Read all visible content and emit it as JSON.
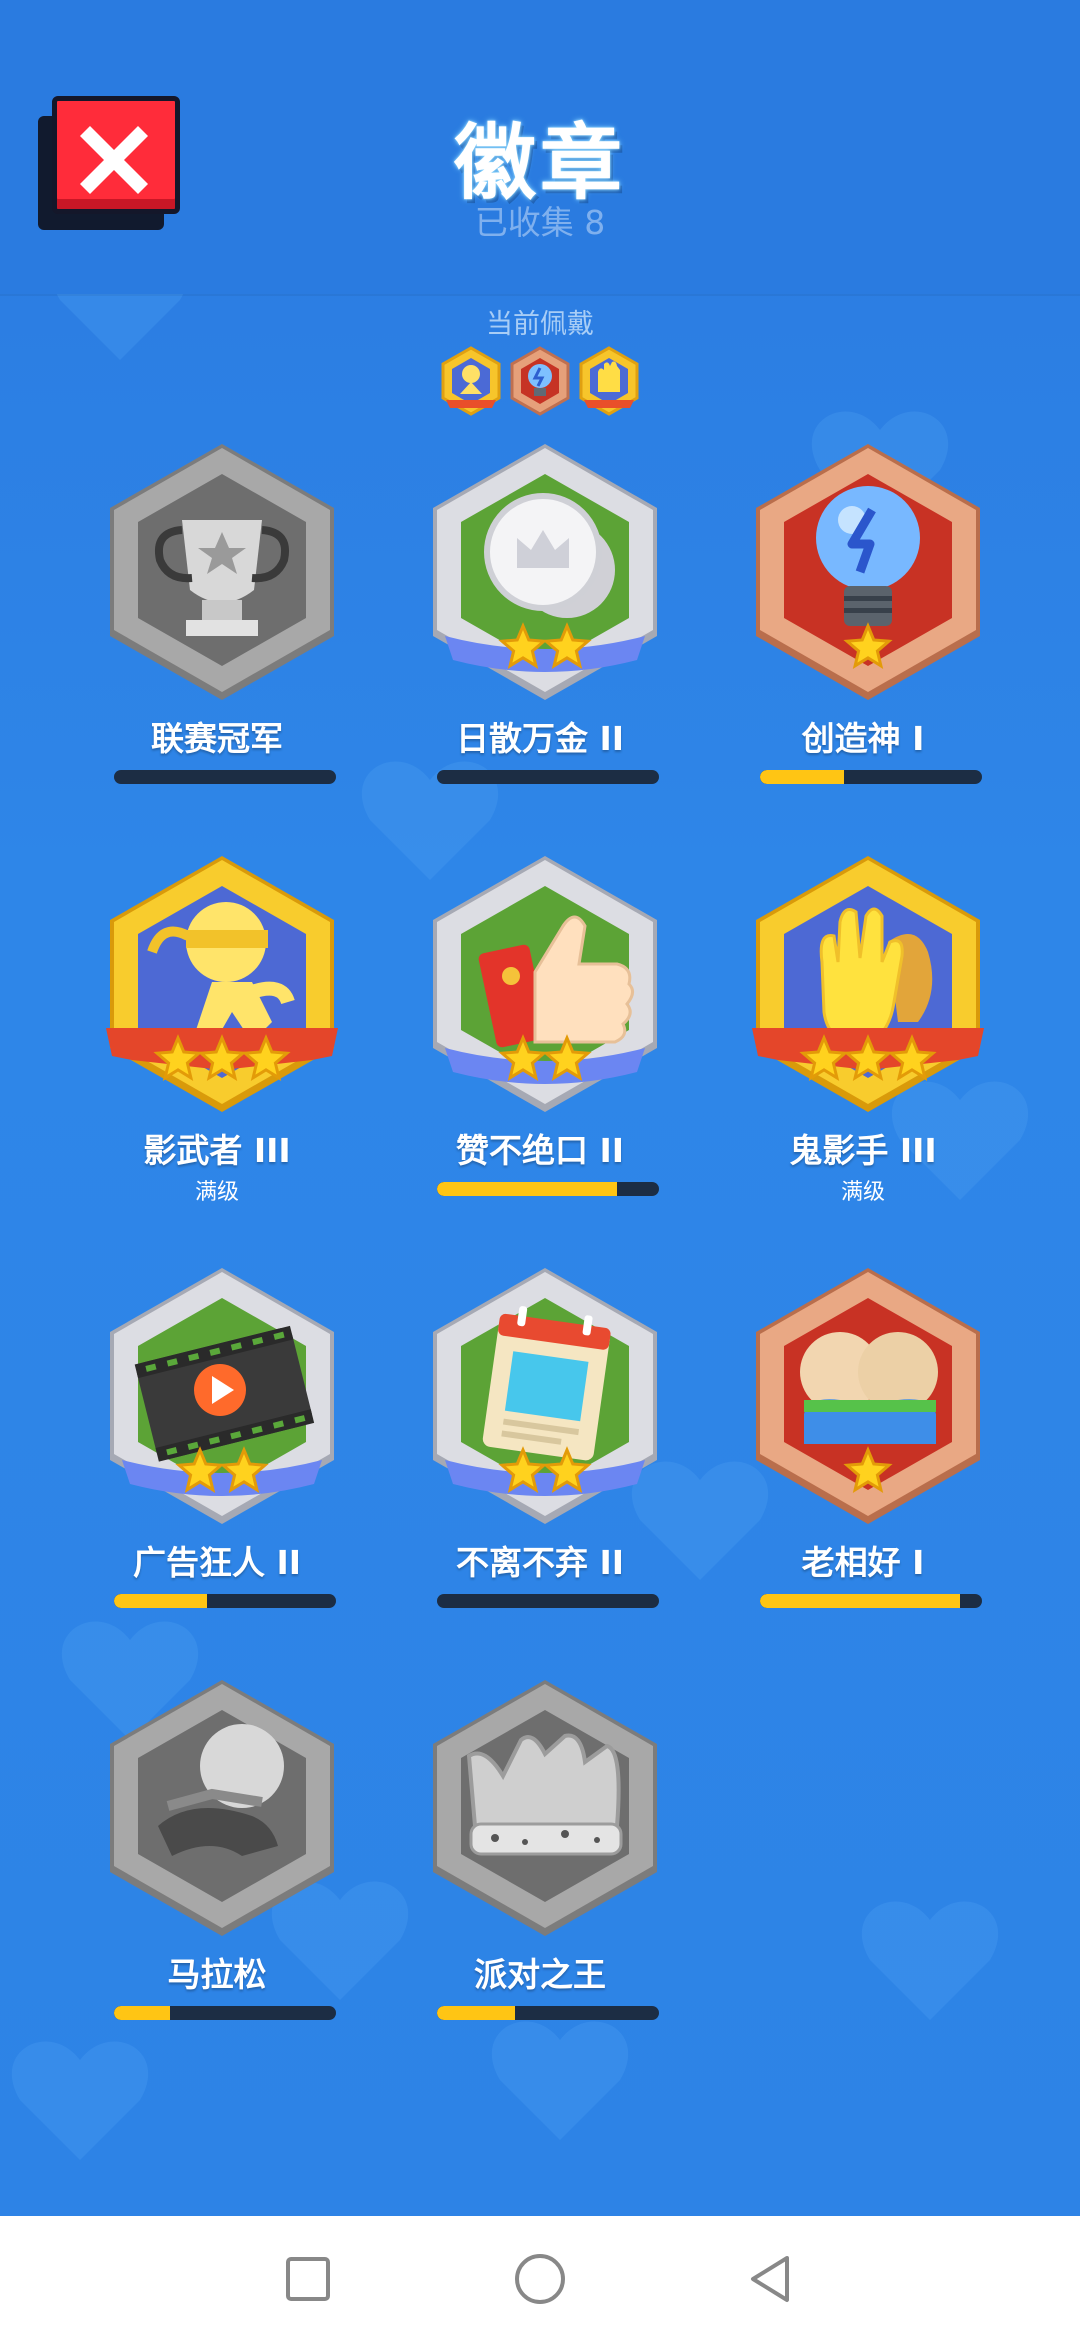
{
  "header": {
    "title": "徽章",
    "subtitle": "已收集 8"
  },
  "worn": {
    "label": "当前佩戴",
    "badges": [
      "shadow-ninja-mini",
      "lightbulb-mini",
      "glove-mini"
    ]
  },
  "badges": [
    {
      "name": "联赛冠军",
      "progress": 0,
      "maxed": false,
      "icon": "trophy-icon",
      "stars": 0,
      "locked": true
    },
    {
      "name": "日散万金 II",
      "progress": 0,
      "maxed": false,
      "icon": "coin-crown-icon",
      "stars": 2
    },
    {
      "name": "创造神 I",
      "progress": 0.38,
      "maxed": false,
      "icon": "lightbulb-icon",
      "stars": 1
    },
    {
      "name": "影武者 III",
      "maxed": true,
      "maxed_label": "满级",
      "icon": "ninja-icon",
      "stars": 3
    },
    {
      "name": "赞不绝口 II",
      "progress": 0.81,
      "maxed": false,
      "icon": "thumbs-up-icon",
      "stars": 2
    },
    {
      "name": "鬼影手 III",
      "maxed": true,
      "maxed_label": "满级",
      "icon": "waving-glove-icon",
      "stars": 3
    },
    {
      "name": "广告狂人 II",
      "progress": 0.42,
      "maxed": false,
      "icon": "film-reel-icon",
      "stars": 2
    },
    {
      "name": "不离不弃 II",
      "progress": 0,
      "maxed": false,
      "icon": "calendar-icon",
      "stars": 2
    },
    {
      "name": "老相好 I",
      "progress": 0.9,
      "maxed": false,
      "icon": "friends-icon",
      "stars": 1
    },
    {
      "name": "马拉松",
      "progress": 0.25,
      "maxed": false,
      "icon": "runner-icon",
      "stars": 0,
      "locked": true
    },
    {
      "name": "派对之王",
      "progress": 0.35,
      "maxed": false,
      "icon": "party-crown-icon",
      "stars": 0,
      "locked": true
    }
  ],
  "colors": {
    "background": "#2d83e6",
    "progress_fill": "#ffc514",
    "progress_track": "#1c2d44",
    "close_button": "#ff2c3a"
  },
  "nav": {
    "buttons": [
      "recent-apps-icon",
      "home-icon",
      "back-icon"
    ]
  }
}
